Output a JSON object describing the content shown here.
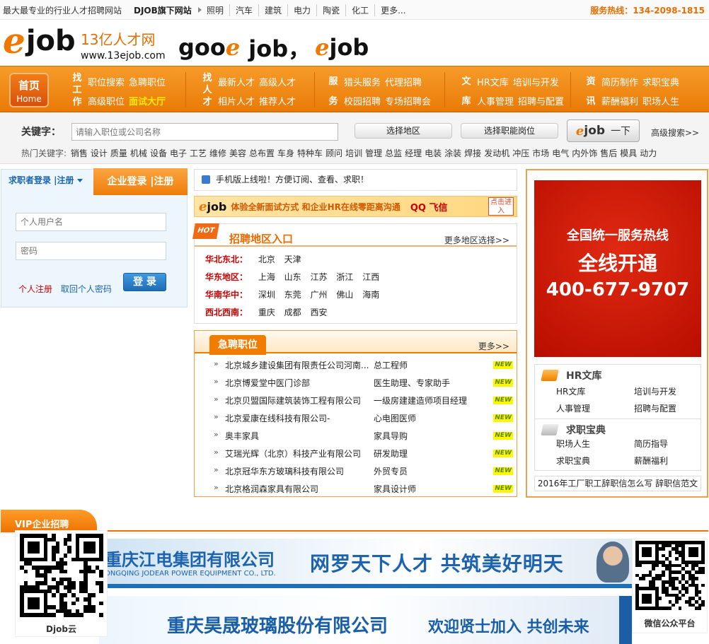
{
  "topbar": {
    "slogan": "最大最专业的行业人才招聘网站",
    "brand": "DJOB旗下网站",
    "sites": [
      "照明",
      "汽车",
      "建筑",
      "电力",
      "陶瓷",
      "化工",
      "更多..."
    ],
    "hotline": "服务热线：134-2098-1815"
  },
  "logo": {
    "e": "e",
    "job": "job",
    "cn": "13亿人才网",
    "url": "www.13ejob.com",
    "slogan_a": "goo",
    "slogan_b": "job，",
    "slogan_c": "job"
  },
  "nav": {
    "home_cn": "首页",
    "home_en": "Home",
    "groups": [
      {
        "label": "找工作",
        "row1": [
          "职位搜索",
          "急聘职位"
        ],
        "row2": [
          "高级职位",
          "面试大厅"
        ]
      },
      {
        "label": "找人才",
        "row1": [
          "最新人才",
          "高级人才"
        ],
        "row2": [
          "相片人才",
          "推荐人才"
        ]
      },
      {
        "label": "服务",
        "row1": [
          "猎头服务",
          "代理招聘"
        ],
        "row2": [
          "校园招聘",
          "专场招聘会"
        ]
      },
      {
        "label": "文库",
        "row1": [
          "HR文库",
          "培训与开发"
        ],
        "row2": [
          "人事管理",
          "招聘与配置"
        ]
      },
      {
        "label": "资讯",
        "row1": [
          "简历制作",
          "求职宝典"
        ],
        "row2": [
          "薪酬福利",
          "职场人生"
        ]
      }
    ]
  },
  "search": {
    "label": "关键字：",
    "placeholder": "请输入职位或公司名称",
    "region_btn": "选择地区",
    "position_btn": "选择职能岗位",
    "go_e": "e",
    "go_job": "job",
    "go_text": "一下",
    "advanced": "高级搜索>>",
    "hot_label": "热门关键字:",
    "hot_words": [
      "销售",
      "设计",
      "质量",
      "机械",
      "设备",
      "电子",
      "工艺",
      "维修",
      "美容",
      "总布置",
      "车身",
      "特种车",
      "顾问",
      "培训",
      "管理",
      "总监",
      "经理",
      "电装",
      "涂装",
      "焊接",
      "发动机",
      "冲压",
      "市场",
      "电气",
      "内外饰",
      "售后",
      "模具",
      "动力"
    ]
  },
  "login": {
    "seeker_tab": "求职者登录 |注册",
    "company_tab": "企业登录 |注册",
    "username_placeholder": "个人用户名",
    "password_placeholder": "密码",
    "register": "个人注册",
    "forgot": "取回个人密码",
    "submit": "登 录"
  },
  "notice": {
    "text": "手机版上线啦！方便订阅、查看、求职！"
  },
  "promo": {
    "e": "e",
    "job": "job",
    "text": "体验全新面试方式  和企业HR在线零距离沟通",
    "qq": "QQ 飞信",
    "enter": "点击进入"
  },
  "regions": {
    "hot": "HOT",
    "title": "招聘地区入口",
    "more": "更多地区选择>>",
    "rows": [
      {
        "label": "华北东北：",
        "cities": [
          "北京",
          "天津"
        ]
      },
      {
        "label": "华东地区：",
        "cities": [
          "上海",
          "山东",
          "江苏",
          "浙江",
          "江西"
        ]
      },
      {
        "label": "华南华中：",
        "cities": [
          "深圳",
          "东莞",
          "广州",
          "佛山",
          "海南"
        ]
      },
      {
        "label": "西北西南：",
        "cities": [
          "重庆",
          "成都",
          "西安"
        ]
      }
    ]
  },
  "urgent": {
    "title": "急聘职位",
    "more": "更多>>",
    "marker": "»",
    "new_badge": "NEW",
    "jobs": [
      {
        "company": "北京城乡建设集团有限责任公司河南...",
        "position": "总工程师"
      },
      {
        "company": "北京博爱堂中医门诊部",
        "position": "医生助理、专家助手"
      },
      {
        "company": "北京贝盟国际建筑装饰工程有限公司",
        "position": "一级房建建造师项目经理"
      },
      {
        "company": "北京爱康在线科技有限公司-",
        "position": "心电图医师"
      },
      {
        "company": "奥丰家具",
        "position": "家具导购"
      },
      {
        "company": "艾瑞光辉（北京）科技产业有限公司",
        "position": "研发助理"
      },
      {
        "company": "北京冠华东方玻璃科技有限公司",
        "position": "外贸专员"
      },
      {
        "company": "北京格润森家具有限公司",
        "position": "家具设计师"
      }
    ]
  },
  "right": {
    "ad_l1": "全国统一服务热线",
    "ad_l2": "全线开通",
    "ad_l3": "400-677-9707",
    "hr_title": "HR文库",
    "hr_items": [
      "HR文库",
      "培训与开发",
      "人事管理",
      "招聘与配置"
    ],
    "job_title": "求职宝典",
    "job_items": [
      "职场人生",
      "简历指导",
      "求职宝典",
      "薪酬福利"
    ],
    "bottom": "2016年工厂职工辞职信怎么写 辞职信范文"
  },
  "vip": {
    "title": "VIP企业招聘",
    "ad1_company": "重庆江电集团有限公司",
    "ad1_en": "ONGQING JODEAR POWER EQUIPMENT CO., LTD.",
    "ad1_slogan": "网罗天下人才  共筑美好明天",
    "ad2_company": "重庆昊晟玻璃股份有限公司",
    "ad2_slogan": "欢迎贤士加入  共创未来"
  },
  "qr": {
    "left_caption": "Djob云",
    "right_caption": "微信公众平台"
  },
  "colors": {
    "accent": "#f07800",
    "nav_orange": "#ea7a06",
    "link_blue": "#1a64b0",
    "region_red": "#cc0000"
  }
}
